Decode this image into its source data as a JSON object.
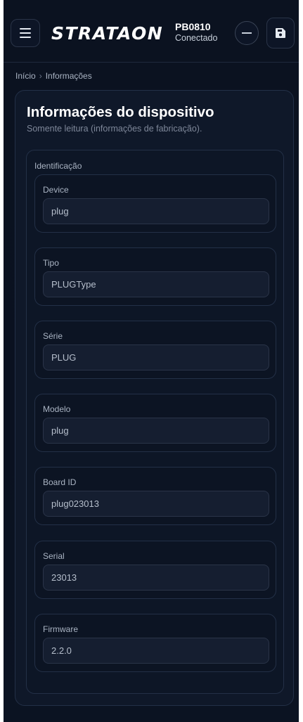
{
  "header": {
    "brand": "STRATAON",
    "device_id": "PB0810",
    "device_status": "Conectado",
    "menu_icon": "hamburger-menu-icon",
    "minimize_icon": "minus-icon",
    "save_icon": "save-icon"
  },
  "breadcrumb": {
    "home": "Início",
    "separator": "›",
    "current": "Informações"
  },
  "card": {
    "title": "Informações do dispositivo",
    "subtitle": "Somente leitura (informações de fabricação).",
    "section": {
      "title": "Identificação",
      "fields": [
        {
          "label": "Device",
          "value": "plug"
        },
        {
          "label": "Tipo",
          "value": "PLUGType"
        },
        {
          "label": "Série",
          "value": "PLUG"
        },
        {
          "label": "Modelo",
          "value": "plug"
        },
        {
          "label": "Board ID",
          "value": "plug023013"
        },
        {
          "label": "Serial",
          "value": "23013"
        },
        {
          "label": "Firmware",
          "value": "2.2.0"
        }
      ]
    }
  },
  "colors": {
    "background": "#0b1220",
    "card": "#0f1829",
    "border": "#233047",
    "text_primary": "#ffffff",
    "text_muted": "#aab4c3"
  }
}
